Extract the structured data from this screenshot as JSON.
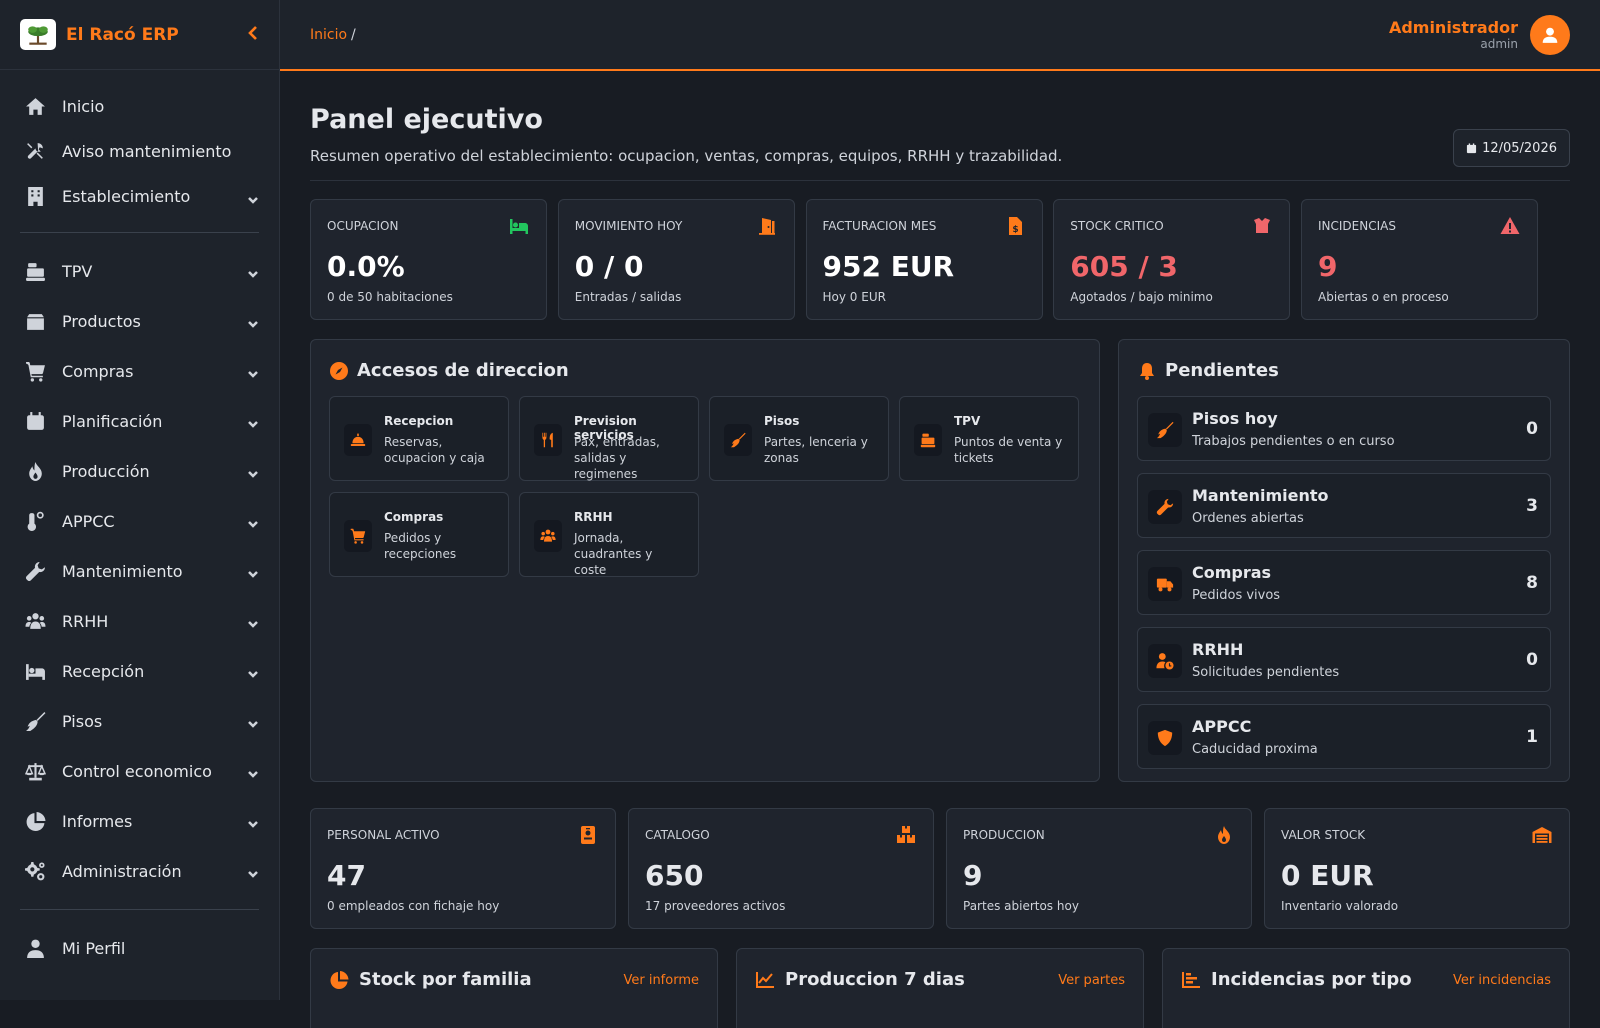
{
  "brand": {
    "name": "El Racó ERP"
  },
  "sidebar": {
    "group1": [
      {
        "label": "Inicio",
        "icon": "home-icon",
        "chevron": false
      },
      {
        "label": "Aviso mantenimiento",
        "icon": "tools-icon",
        "chevron": false
      },
      {
        "label": "Establecimiento",
        "icon": "building-icon",
        "chevron": true
      }
    ],
    "group2": [
      {
        "label": "TPV",
        "icon": "cash-register-icon"
      },
      {
        "label": "Productos",
        "icon": "box-icon"
      },
      {
        "label": "Compras",
        "icon": "cart-icon"
      },
      {
        "label": "Planificación",
        "icon": "calendar-icon"
      },
      {
        "label": "Producción",
        "icon": "fire-icon"
      },
      {
        "label": "APPCC",
        "icon": "thermometer-icon"
      },
      {
        "label": "Mantenimiento",
        "icon": "wrench-icon"
      },
      {
        "label": "RRHH",
        "icon": "users-icon"
      },
      {
        "label": "Recepción",
        "icon": "bed-icon"
      },
      {
        "label": "Pisos",
        "icon": "broom-icon"
      },
      {
        "label": "Control economico",
        "icon": "scale-icon"
      },
      {
        "label": "Informes",
        "icon": "pie-chart-icon"
      },
      {
        "label": "Administración",
        "icon": "cogs-icon"
      }
    ],
    "group3": [
      {
        "label": "Mi Perfil",
        "icon": "user-icon"
      }
    ]
  },
  "topbar": {
    "breadcrumb": "Inicio",
    "breadcrumb_sep": "/",
    "user_name": "Administrador",
    "user_role": "admin"
  },
  "page": {
    "title": "Panel ejecutivo",
    "subtitle": "Resumen operativo del establecimiento: ocupacion, ventas, compras, equipos, RRHH y trazabilidad.",
    "date": "12/05/2026"
  },
  "kpis": [
    {
      "title": "OCUPACION",
      "value": "0.0%",
      "sub": "0 de 50 habitaciones",
      "icon": "bed-icon",
      "icon_color": "#22c55e",
      "value_color": "#ffffff"
    },
    {
      "title": "MOVIMIENTO HOY",
      "value": "0 / 0",
      "sub": "Entradas / salidas",
      "icon": "door-icon",
      "icon_color": "#ff7a1a",
      "value_color": "#ffffff"
    },
    {
      "title": "FACTURACION MES",
      "value": "952 EUR",
      "sub": "Hoy 0 EUR",
      "icon": "invoice-icon",
      "icon_color": "#ff7a1a",
      "value_color": "#ffffff"
    },
    {
      "title": "STOCK CRITICO",
      "value": "605 / 3",
      "sub": "Agotados / bajo minimo",
      "icon": "open-box-icon",
      "icon_color": "#f0666a",
      "value_color": "#f0666a"
    },
    {
      "title": "INCIDENCIAS",
      "value": "9",
      "sub": "Abiertas o en proceso",
      "icon": "warning-icon",
      "icon_color": "#f0666a",
      "value_color": "#f0666a"
    }
  ],
  "accesos": {
    "title": "Accesos de direccion",
    "items": [
      {
        "title": "Recepcion",
        "desc": "Reservas, ocupacion y caja",
        "icon": "bell-service-icon"
      },
      {
        "title": "Prevision servicios",
        "desc": "Pax, entradas, salidas y regimenes",
        "icon": "utensils-icon"
      },
      {
        "title": "Pisos",
        "desc": "Partes, lenceria y zonas",
        "icon": "broom-icon"
      },
      {
        "title": "TPV",
        "desc": "Puntos de venta y tickets",
        "icon": "cash-register-icon"
      },
      {
        "title": "Compras",
        "desc": "Pedidos y recepciones",
        "icon": "cart-icon"
      },
      {
        "title": "RRHH",
        "desc": "Jornada, cuadrantes y coste",
        "icon": "users-icon"
      }
    ]
  },
  "pendientes": {
    "title": "Pendientes",
    "items": [
      {
        "title": "Pisos hoy",
        "desc": "Trabajos pendientes o en curso",
        "count": "0",
        "icon": "broom-icon"
      },
      {
        "title": "Mantenimiento",
        "desc": "Ordenes abiertas",
        "count": "3",
        "icon": "wrench-icon"
      },
      {
        "title": "Compras",
        "desc": "Pedidos vivos",
        "count": "8",
        "icon": "truck-icon"
      },
      {
        "title": "RRHH",
        "desc": "Solicitudes pendientes",
        "count": "0",
        "icon": "user-clock-icon"
      },
      {
        "title": "APPCC",
        "desc": "Caducidad proxima",
        "count": "1",
        "icon": "shield-icon"
      }
    ]
  },
  "kpis2": [
    {
      "title": "PERSONAL ACTIVO",
      "value": "47",
      "sub": "0 empleados con fichaje hoy",
      "icon": "id-badge-icon"
    },
    {
      "title": "CATALOGO",
      "value": "650",
      "sub": "17 proveedores activos",
      "icon": "boxes-icon"
    },
    {
      "title": "PRODUCCION",
      "value": "9",
      "sub": "Partes abiertos hoy",
      "icon": "fire-icon"
    },
    {
      "title": "VALOR STOCK",
      "value": "0 EUR",
      "sub": "Inventario valorado",
      "icon": "warehouse-icon"
    }
  ],
  "bottom": [
    {
      "title": "Stock por familia",
      "link": "Ver informe",
      "icon": "pie-chart-icon"
    },
    {
      "title": "Produccion 7 dias",
      "link": "Ver partes",
      "icon": "line-chart-icon"
    },
    {
      "title": "Incidencias por tipo",
      "link": "Ver incidencias",
      "icon": "bar-chart-icon"
    }
  ],
  "colors": {
    "accent": "#ff7a1a",
    "danger": "#f0666a",
    "success": "#22c55e"
  }
}
